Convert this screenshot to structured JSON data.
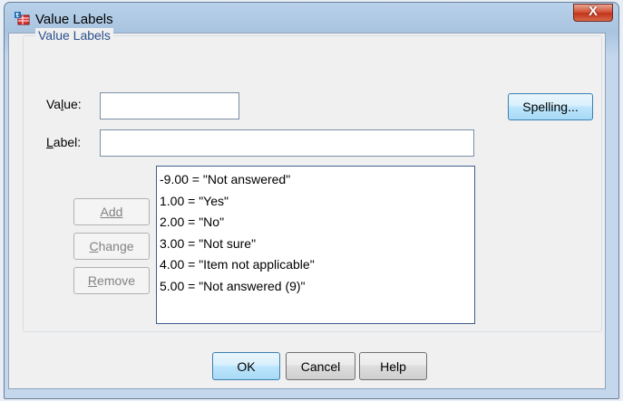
{
  "window": {
    "title": "Value Labels",
    "close_label": "X"
  },
  "group": {
    "label": "Value Labels"
  },
  "value_field": {
    "label_pre": "Va",
    "label_mnemonic": "l",
    "label_post": "ue:",
    "value": ""
  },
  "label_field": {
    "label_mnemonic": "L",
    "label_post": "abel:",
    "value": ""
  },
  "buttons": {
    "spelling": "Spelling...",
    "add": "Add",
    "change_mnemonic": "C",
    "change_rest": "hange",
    "remove_mnemonic": "R",
    "remove_rest": "emove",
    "ok": "OK",
    "cancel": "Cancel",
    "help": "Help"
  },
  "value_labels": [
    "-9.00 = \"Not answered\"",
    "1.00 = \"Yes\"",
    "2.00 = \"No\"",
    "3.00 = \"Not sure\"",
    "4.00 = \"Item not applicable\"",
    "5.00 = \"Not answered (9)\""
  ],
  "colors": {
    "group_label": "#2b4f8c",
    "accent_button_border": "#3c7fb1",
    "close_button": "#c0331a"
  }
}
